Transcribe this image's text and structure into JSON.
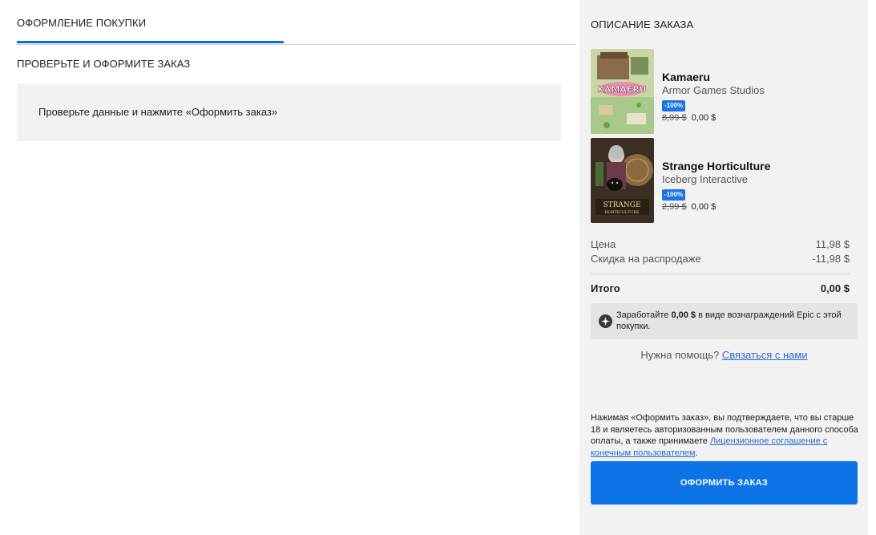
{
  "checkout": {
    "tab_label": "ОФОРМЛЕНИЕ ПОКУПКИ",
    "section_title": "ПРОВЕРЬТЕ И ОФОРМИТЕ ЗАКАЗ",
    "review_message": "Проверьте данные и нажмите «Оформить заказ»"
  },
  "order": {
    "title": "ОПИСАНИЕ ЗАКАЗА",
    "items": [
      {
        "name": "Kamaeru",
        "publisher": "Armor Games Studios",
        "discount": "-100%",
        "old_price": "8,99 $",
        "new_price": "0,00 $",
        "thumb_icon": "kamaeru-cover-art"
      },
      {
        "name": "Strange Horticulture",
        "publisher": "Iceberg Interactive",
        "discount": "-100%",
        "old_price": "2,99 $",
        "new_price": "0,00 $",
        "thumb_icon": "strange-horticulture-cover-art"
      }
    ],
    "price_label": "Цена",
    "price_value": "11,98 $",
    "sale_label": "Скидка на распродаже",
    "sale_value": "-11,98 $",
    "total_label": "Итого",
    "total_value": "0,00 $",
    "rewards_prefix": "Заработайте ",
    "rewards_amount": "0,00 $",
    "rewards_suffix": " в виде вознаграждений Epic с этой покупки.",
    "help_text": "Нужна помощь? ",
    "help_link": "Связаться с нами",
    "legal_text": "Нажимая «Оформить заказ», вы подтверждаете, что вы старше 18 и являетесь авторизованным пользователем данного способа оплаты, а также принимаете ",
    "legal_link": "Лицензионное соглашение с конечным пользователем",
    "legal_end": ".",
    "place_order_label": "ОФОРМИТЬ ЗАКАЗ"
  },
  "colors": {
    "accent": "#0d74e7",
    "panel_bg": "#f2f2f2",
    "badge": "#1a73e8"
  }
}
